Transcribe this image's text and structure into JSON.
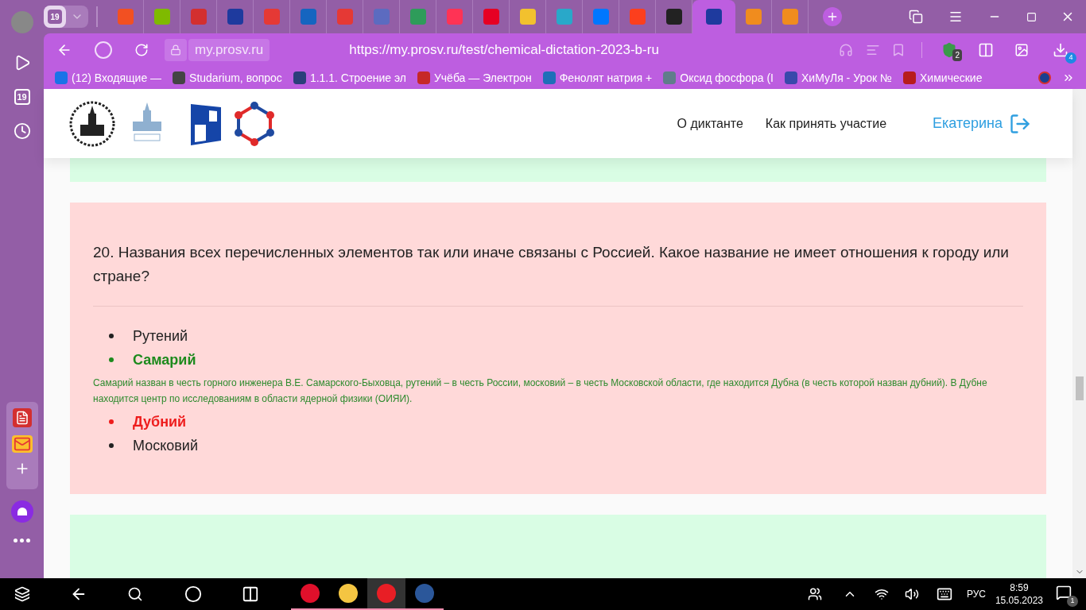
{
  "tab_strip": {
    "group_count": "19",
    "tabs": [
      {
        "selected": false,
        "color": "#f25022"
      },
      {
        "selected": false,
        "color": "#7fba00"
      },
      {
        "selected": false,
        "color": "#d32f2f"
      },
      {
        "selected": false,
        "color": "#1e3a9e"
      },
      {
        "selected": false,
        "color": "#e53935"
      },
      {
        "selected": false,
        "color": "#1565c0"
      },
      {
        "selected": false,
        "color": "#e53935"
      },
      {
        "selected": false,
        "color": "#5c6bc0"
      },
      {
        "selected": false,
        "color": "#2e9c5a"
      },
      {
        "selected": false,
        "color": "#ff3355"
      },
      {
        "selected": false,
        "color": "#e60023"
      },
      {
        "selected": false,
        "color": "#f2c12e"
      },
      {
        "selected": false,
        "color": "#29a8c9"
      },
      {
        "selected": false,
        "color": "#0077ff"
      },
      {
        "selected": false,
        "color": "#fc3f1d"
      },
      {
        "selected": false,
        "color": "#222222"
      },
      {
        "selected": true,
        "color": "#1e3a9e"
      },
      {
        "selected": false,
        "color": "#f08c1e"
      },
      {
        "selected": false,
        "color": "#f08c1e"
      }
    ]
  },
  "sidebar": {
    "badge": "19"
  },
  "toolbar": {
    "site": "my.prosv.ru",
    "url": "https://my.prosv.ru/test/chemical-dictation-2023-b-ru",
    "protect_count": "2",
    "downloads_count": "4"
  },
  "bookmarks": [
    {
      "label": "(12) Входящие —",
      "color": "#1a73e8"
    },
    {
      "label": "Studarium, вопрос",
      "color": "#444444"
    },
    {
      "label": "1.1.1. Строение эл",
      "color": "#2a3f7a"
    },
    {
      "label": "Учёба — Электрон",
      "color": "#c62828"
    },
    {
      "label": "Фенолят натрия +",
      "color": "#1e6fb8"
    },
    {
      "label": "Оксид фосфора (I",
      "color": "#607d8b"
    },
    {
      "label": "ХиМуЛя - Урок №",
      "color": "#3949ab"
    },
    {
      "label": "Химические",
      "color": "#b71c1c"
    }
  ],
  "header": {
    "nav": [
      "О диктанте",
      "Как принять участие"
    ],
    "user": "Екатерина"
  },
  "question": {
    "text": "20. Названия всех перечисленных элементов так или иначе связаны с Россией. Какое название не имеет отношения к городу или стране?",
    "options": [
      {
        "label": "Рутений",
        "kind": "plain"
      },
      {
        "label": "Самарий",
        "kind": "correct",
        "note": "Самарий назван в честь горного инженера В.Е. Самарского-Быховца, рутений – в честь России, московий – в честь Московской области, где находится Дубна (в честь которой назван дубний). В Дубне находится центр по исследованиям в области ядерной физики (ОИЯИ)."
      },
      {
        "label": "Дубний",
        "kind": "incorrect"
      },
      {
        "label": "Московий",
        "kind": "plain"
      }
    ]
  },
  "taskbar": {
    "apps": [
      {
        "selected": false,
        "color": "#e0102b"
      },
      {
        "selected": false,
        "color": "#f4c542"
      },
      {
        "selected": true,
        "color": "#e81e25"
      },
      {
        "selected": false,
        "color": "#2b579a"
      }
    ],
    "language": "РУС",
    "time": "8:59",
    "date": "15.05.2023",
    "notifications": "1"
  }
}
